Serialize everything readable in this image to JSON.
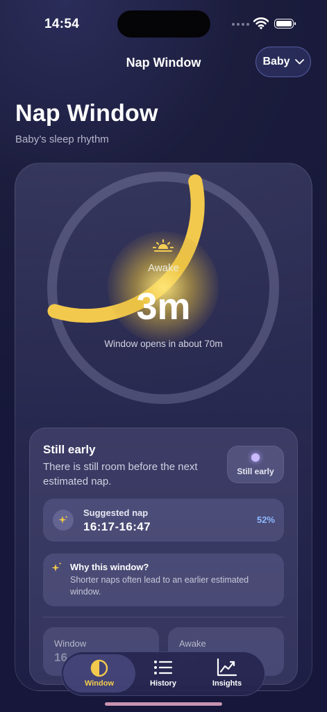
{
  "status_bar": {
    "time": "14:54"
  },
  "nav": {
    "title": "Nap Window",
    "baby_selector": "Baby"
  },
  "header": {
    "title": "Nap Window",
    "subtitle": "Baby’s sleep rhythm"
  },
  "timer": {
    "state_label": "Awake",
    "elapsed": "3m",
    "caption": "Window opens in about 70m",
    "ring_progress": 0.33,
    "accent_color": "#F2C94C"
  },
  "status": {
    "title": "Still early",
    "description": "There is still room before the next estimated nap.",
    "pill_label": "Still early"
  },
  "suggestion": {
    "label": "Suggested nap",
    "time_range": "16:17-16:47",
    "confidence": "52%"
  },
  "why": {
    "title": "Why this window?",
    "description": "Shorter naps often lead to an earlier estimated window."
  },
  "stats": [
    {
      "label": "Window",
      "value": "16"
    },
    {
      "label": "Awake",
      "value": "0m"
    }
  ],
  "tabs": [
    {
      "label": "Window",
      "icon": "half-circle-icon",
      "active": true
    },
    {
      "label": "History",
      "icon": "list-icon",
      "active": false
    },
    {
      "label": "Insights",
      "icon": "chart-icon",
      "active": false
    }
  ]
}
